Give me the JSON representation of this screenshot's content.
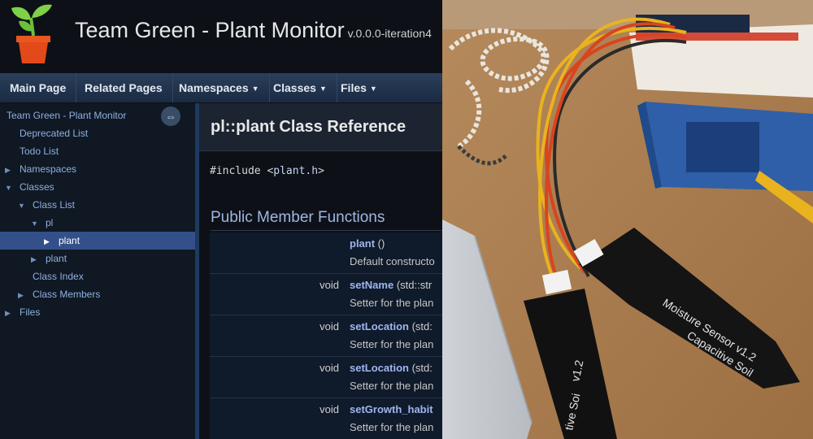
{
  "header": {
    "project_name": "Team Green - Plant Monitor",
    "version": "v.0.0.0-iteration4"
  },
  "navbar": {
    "items": [
      "Main Page",
      "Related Pages",
      "Namespaces",
      "Classes",
      "Files"
    ]
  },
  "sidebar": {
    "tree": [
      {
        "label": "Team Green - Plant Monitor",
        "expander": ""
      },
      {
        "label": "Deprecated List",
        "expander": ""
      },
      {
        "label": "Todo List",
        "expander": ""
      },
      {
        "label": "Namespaces",
        "expander": "▶"
      },
      {
        "label": "Classes",
        "expander": "▼"
      },
      {
        "label": "Class List",
        "expander": "▼"
      },
      {
        "label": "pl",
        "expander": "▼"
      },
      {
        "label": "plant",
        "expander": "▶",
        "selected": true
      },
      {
        "label": "plant",
        "expander": "▶"
      },
      {
        "label": "Class Index",
        "expander": ""
      },
      {
        "label": "Class Members",
        "expander": "▶"
      },
      {
        "label": "Files",
        "expander": "▶"
      }
    ]
  },
  "content": {
    "title": "pl::plant Class Reference",
    "include_prefix": "#include <",
    "include_file": "plant.h",
    "include_suffix": ">",
    "section_title": "Public Member Functions",
    "members": [
      {
        "type": "",
        "name": "plant",
        "args": " ()",
        "desc": "Default constructo"
      },
      {
        "type": "void",
        "name": "setName",
        "args": " (std::str",
        "desc": "Setter for the plan"
      },
      {
        "type": "void",
        "name": "setLocation",
        "args": " (std:",
        "desc": "Setter for the plan"
      },
      {
        "type": "void",
        "name": "setLocation",
        "args": " (std:",
        "desc": "Setter for the plan"
      },
      {
        "type": "void",
        "name": "setGrowth_habit",
        "args": "",
        "desc": "Setter for the plan"
      }
    ]
  },
  "photo": {
    "sensor_front_text": "Capacitive Soil",
    "sensor_front_text2": "Moisture Sensor v1.2",
    "sensor_back_text": "v1.2",
    "sensor_back_text2": "tive Soi"
  }
}
